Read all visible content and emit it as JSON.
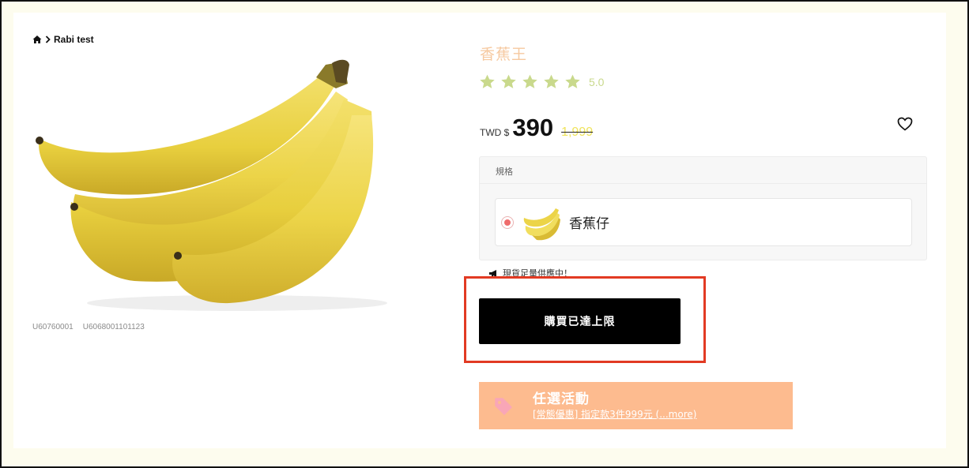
{
  "breadcrumb": {
    "home_icon": "home-icon",
    "separator_icon": "chevron-right-icon",
    "current": "Rabi test"
  },
  "product": {
    "image_icon": "banana-bunch-image",
    "sku_codes": [
      "U60760001",
      "U6068001101123"
    ],
    "title": "香蕉王",
    "rating": {
      "stars_filled": 5,
      "stars_total": 5,
      "value": "5.0",
      "star_color": "#c9d98c"
    },
    "price": {
      "currency": "TWD $",
      "current": "390",
      "original": "1,999"
    },
    "wishlist_icon": "heart-icon"
  },
  "spec": {
    "header": "規格",
    "options": [
      {
        "label": "香蕉仔",
        "selected": true
      }
    ]
  },
  "stock_note": {
    "icon": "megaphone-icon",
    "text": "現貨足量供應中！"
  },
  "buy_button": {
    "label": "購買已達上限"
  },
  "promo": {
    "icon": "tag-icon",
    "title": "任選活動",
    "subtitle": "[常態優惠] 指定款3件999元 (...more)",
    "color": "#fdbb8f"
  },
  "colors": {
    "title": "#f6c9a0",
    "highlight": "#e23a23",
    "page_bg": "#fdfcee"
  }
}
